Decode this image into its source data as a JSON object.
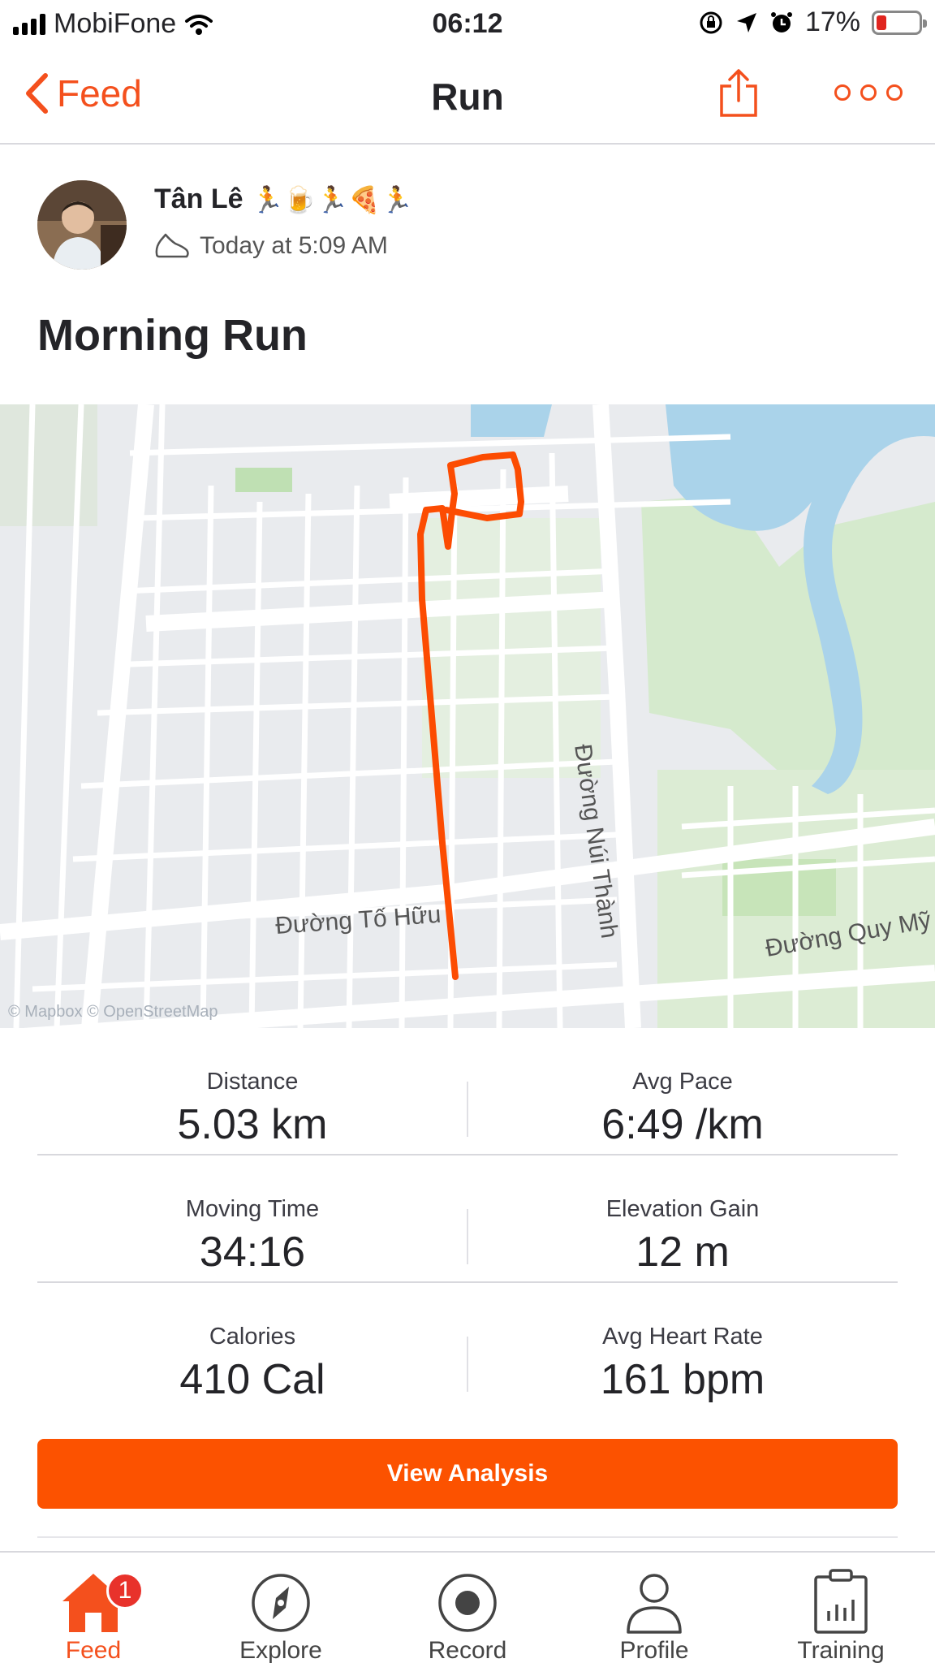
{
  "status_bar": {
    "carrier": "MobiFone",
    "time": "06:12",
    "battery": "17%",
    "battery_level": 0.17,
    "icons": [
      "signal-icon",
      "wifi-icon",
      "rotation-lock-icon",
      "location-arrow-icon",
      "alarm-icon",
      "battery-icon"
    ]
  },
  "nav": {
    "back_label": "Feed",
    "title": "Run",
    "share_icon": "share-icon",
    "more_icon": "more-dots-icon"
  },
  "athlete": {
    "name": "Tân Lê",
    "name_emojis": "🏃🍺🏃🍕🏃",
    "activity_icon": "shoe-icon",
    "activity_time": "Today at 5:09 AM"
  },
  "activity": {
    "title": "Morning Run"
  },
  "map": {
    "street_labels": [
      "Đường Tố Hữu",
      "Đường Núi Thành",
      "Đường Quy Mỹ"
    ],
    "attribution": "© Mapbox © OpenStreetMap",
    "route_color": "#fc4c02",
    "water_color": "#aad3ea",
    "park_color": "#d6ecd2"
  },
  "stats": [
    {
      "label": "Distance",
      "value": "5.03 km"
    },
    {
      "label": "Avg Pace",
      "value": "6:49 /km"
    },
    {
      "label": "Moving Time",
      "value": "34:16"
    },
    {
      "label": "Elevation Gain",
      "value": "12 m"
    },
    {
      "label": "Calories",
      "value": "410 Cal"
    },
    {
      "label": "Avg Heart Rate",
      "value": "161 bpm"
    }
  ],
  "view_analysis_label": "View Analysis",
  "tabbar": {
    "items": [
      {
        "label": "Feed",
        "icon": "home-icon",
        "active": true,
        "badge": "1"
      },
      {
        "label": "Explore",
        "icon": "compass-icon"
      },
      {
        "label": "Record",
        "icon": "record-icon"
      },
      {
        "label": "Profile",
        "icon": "person-icon"
      },
      {
        "label": "Training",
        "icon": "training-chart-icon"
      }
    ]
  },
  "colors": {
    "accent": "#fc5200",
    "text": "#242428"
  }
}
